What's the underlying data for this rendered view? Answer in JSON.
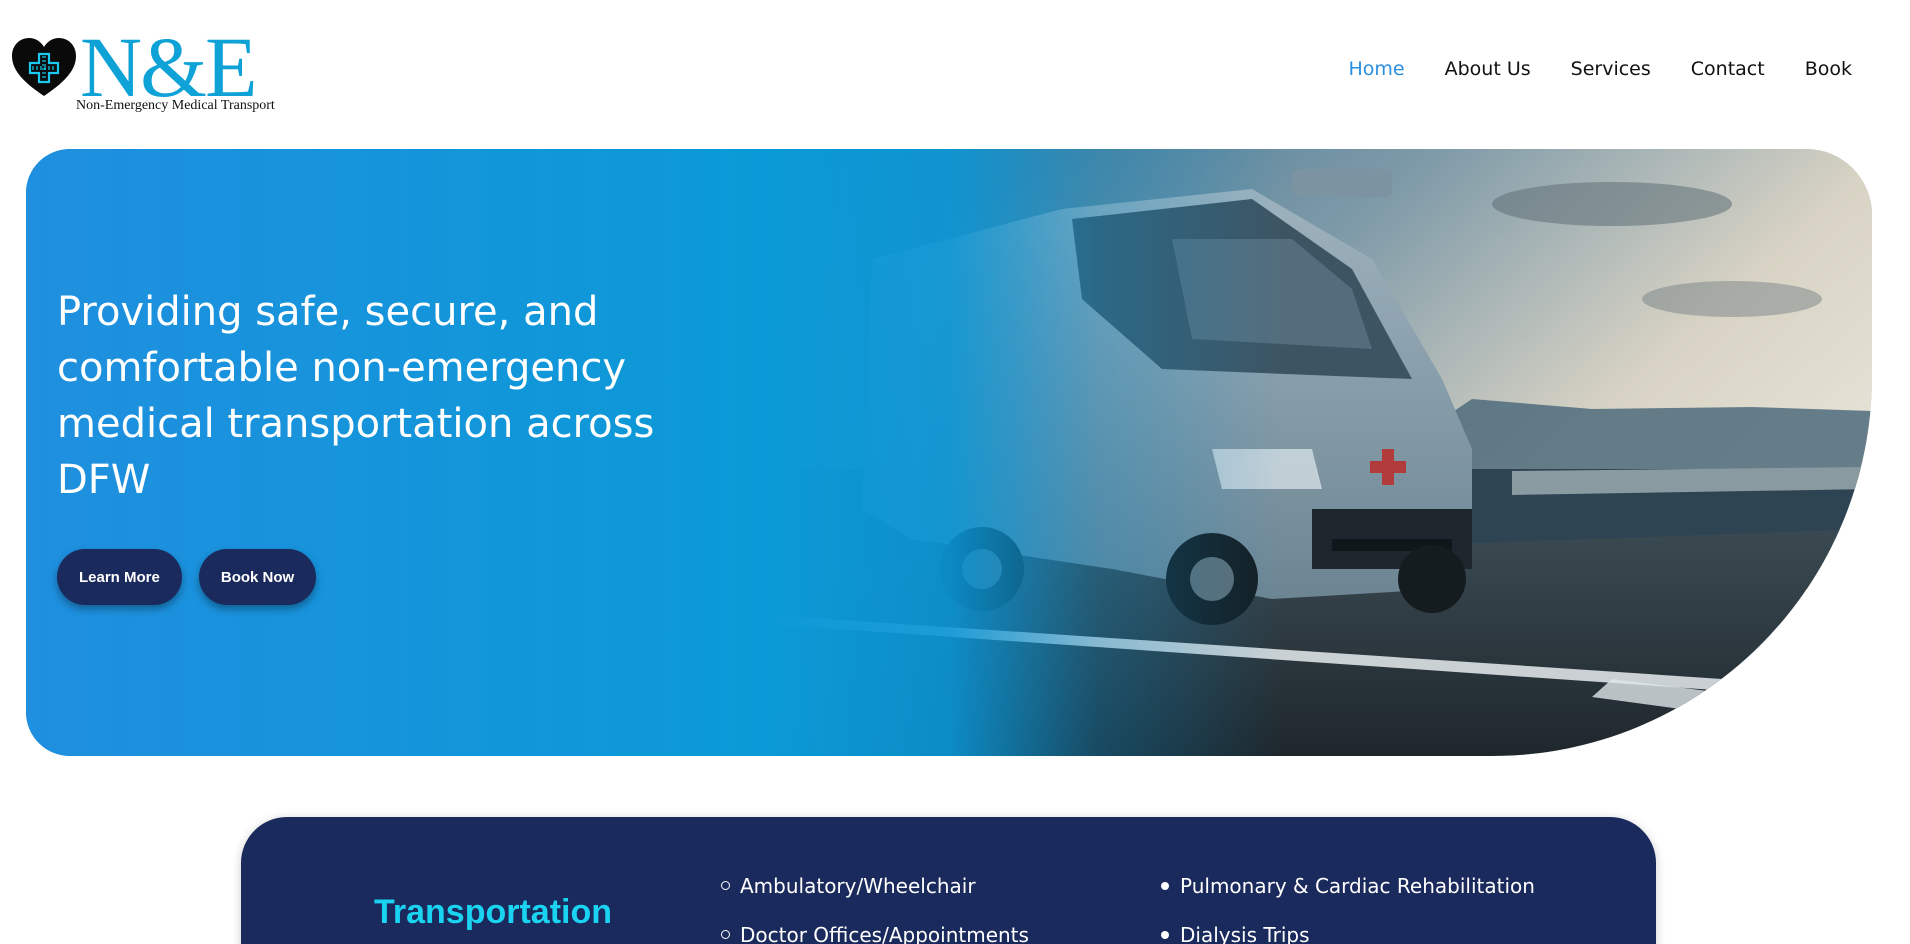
{
  "brand": {
    "logo_mark": "N&E",
    "tagline": "Non-Emergency Medical Transport",
    "icon": "heart-medical-cross-icon",
    "color": "#0ea2d6"
  },
  "nav": {
    "items": [
      {
        "label": "Home",
        "active": true
      },
      {
        "label": "About Us",
        "active": false
      },
      {
        "label": "Services",
        "active": false
      },
      {
        "label": "Contact",
        "active": false
      },
      {
        "label": "Book",
        "active": false
      }
    ],
    "active_color": "#2b8fe0"
  },
  "hero": {
    "headline": "Providing safe, secure, and comfortable non-emergency medical transportation across DFW",
    "learn_more_label": "Learn More",
    "book_now_label": "Book Now",
    "image": "medical-van-on-highway-photo",
    "gradient_colors": [
      "#3f87e4",
      "#0a9cd8"
    ],
    "button_color": "#1b2a5c"
  },
  "services": {
    "title": "Transportation",
    "title_color": "#19d3f0",
    "background": "#1b2a5c",
    "column_1": [
      "Ambulatory/Wheelchair",
      "Doctor Offices/Appointments"
    ],
    "column_2": [
      "Pulmonary & Cardiac Rehabilitation",
      "Dialysis Trips"
    ]
  }
}
